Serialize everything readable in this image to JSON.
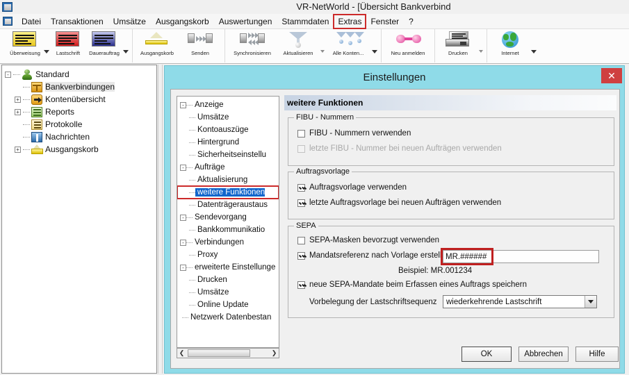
{
  "window": {
    "title": "VR-NetWorld - [Übersicht Bankverbind",
    "app_icon": "app-icon"
  },
  "menubar": {
    "items": [
      {
        "label": "Datei",
        "highlight": false
      },
      {
        "label": "Transaktionen",
        "highlight": false
      },
      {
        "label": "Umsätze",
        "highlight": false
      },
      {
        "label": "Ausgangskorb",
        "highlight": false
      },
      {
        "label": "Auswertungen",
        "highlight": false
      },
      {
        "label": "Stammdaten",
        "highlight": false
      },
      {
        "label": "Extras",
        "highlight": true
      },
      {
        "label": "Fenster",
        "highlight": false
      },
      {
        "label": "?",
        "highlight": false
      }
    ],
    "highlight_color": "#cc2a2a"
  },
  "toolbar": {
    "buttons": [
      {
        "label": "Überweisung",
        "icon": "transfer-card-icon"
      },
      {
        "label": "Lastschrift",
        "icon": "direct-debit-card-icon"
      },
      {
        "label": "Dauerauftrag",
        "icon": "standing-order-card-icon"
      },
      {
        "label": "Ausgangskorb",
        "icon": "outbox-tray-icon"
      },
      {
        "label": "Senden",
        "icon": "send-blocks-icon"
      },
      {
        "label": "Synchronisieren",
        "icon": "synchronize-blocks-icon"
      },
      {
        "label": "Aktualisieren",
        "icon": "refresh-funnel-icon"
      },
      {
        "label": "Alle Konten...",
        "icon": "all-accounts-funnels-icon"
      },
      {
        "label": "Neu anmelden",
        "icon": "relogin-plugs-icon"
      },
      {
        "label": "Drucken",
        "icon": "printer-icon"
      },
      {
        "label": "Internet",
        "icon": "globe-icon"
      }
    ]
  },
  "sidebar": {
    "items": [
      {
        "label": "Standard",
        "icon": "user-icon",
        "expander": "-",
        "level": 0,
        "selected": false
      },
      {
        "label": "Bankverbindungen",
        "icon": "bank-icon",
        "expander": "",
        "level": 1,
        "selected": true
      },
      {
        "label": "Kontenübersicht",
        "icon": "account-icon",
        "expander": "+",
        "level": 1,
        "selected": false
      },
      {
        "label": "Reports",
        "icon": "reports-icon",
        "expander": "+",
        "level": 1,
        "selected": false
      },
      {
        "label": "Protokolle",
        "icon": "protocol-icon",
        "expander": "",
        "level": 1,
        "selected": false
      },
      {
        "label": "Nachrichten",
        "icon": "messages-icon",
        "expander": "",
        "level": 1,
        "selected": false
      },
      {
        "label": "Ausgangskorb",
        "icon": "outbox-icon",
        "expander": "+",
        "level": 1,
        "selected": false
      }
    ]
  },
  "dialog": {
    "title": "Einstellungen",
    "close_label": "✕",
    "titlebar_color": "#8fdbe8",
    "close_color": "#cf4040",
    "panel_header": "weitere Funktionen",
    "tree": [
      {
        "label": "Anzeige",
        "expander": "-",
        "level": 0,
        "selected": false
      },
      {
        "label": "Umsätze",
        "expander": "",
        "level": 1,
        "selected": false
      },
      {
        "label": "Kontoauszüge",
        "expander": "",
        "level": 1,
        "selected": false
      },
      {
        "label": "Hintergrund",
        "expander": "",
        "level": 1,
        "selected": false
      },
      {
        "label": "Sicherheitseinstellu",
        "expander": "",
        "level": 1,
        "selected": false
      },
      {
        "label": "Aufträge",
        "expander": "-",
        "level": 0,
        "selected": false
      },
      {
        "label": "Aktualisierung",
        "expander": "",
        "level": 1,
        "selected": false
      },
      {
        "label": "weitere Funktionen",
        "expander": "",
        "level": 1,
        "selected": true
      },
      {
        "label": "Datenträgeraustaus",
        "expander": "",
        "level": 1,
        "selected": false
      },
      {
        "label": "Sendevorgang",
        "expander": "-",
        "level": 0,
        "selected": false
      },
      {
        "label": "Bankkommunikatio",
        "expander": "",
        "level": 1,
        "selected": false
      },
      {
        "label": "Verbindungen",
        "expander": "-",
        "level": 0,
        "selected": false
      },
      {
        "label": "Proxy",
        "expander": "",
        "level": 1,
        "selected": false
      },
      {
        "label": "erweiterte Einstellunge",
        "expander": "-",
        "level": 0,
        "selected": false
      },
      {
        "label": "Drucken",
        "expander": "",
        "level": 1,
        "selected": false
      },
      {
        "label": "Umsätze",
        "expander": "",
        "level": 1,
        "selected": false
      },
      {
        "label": "Online Update",
        "expander": "",
        "level": 1,
        "selected": false
      },
      {
        "label": "Netzwerk Datenbestan",
        "expander": "",
        "level": 0,
        "selected": false
      }
    ],
    "tree_scroll": {
      "left_arrow": "❮",
      "right_arrow": "❯"
    },
    "groups": {
      "fibu": {
        "legend": "FIBU - Nummern",
        "checkboxes": [
          {
            "label": "FIBU - Nummern verwenden",
            "checked": false,
            "disabled": false
          },
          {
            "label": "letzte FIBU - Nummer bei neuen Aufträgen verwenden",
            "checked": false,
            "disabled": true
          }
        ]
      },
      "auftragsvorlage": {
        "legend": "Auftragsvorlage",
        "checkboxes": [
          {
            "label": "Auftragsvorlage verwenden",
            "checked": true,
            "disabled": false
          },
          {
            "label": "letzte Auftragsvorlage bei neuen Aufträgen verwenden",
            "checked": true,
            "disabled": false
          }
        ]
      },
      "sepa": {
        "legend": "SEPA",
        "checkboxes": [
          {
            "label": "SEPA-Masken bevorzugt verwenden",
            "checked": false,
            "disabled": false
          },
          {
            "label": "Mandatsreferenz nach Vorlage erstellen",
            "checked": true,
            "disabled": false
          },
          {
            "label": "neue SEPA-Mandate beim Erfassen eines Auftrags speichern",
            "checked": true,
            "disabled": false
          }
        ],
        "mandate_template_value": "MR.######",
        "mandate_template_highlight": "#c02020",
        "example_text": "Beispiel: MR.001234",
        "sequence_label": "Vorbelegung der Lastschriftsequenz",
        "sequence_value": "wiederkehrende Lastschrift"
      }
    },
    "buttons": {
      "ok": "OK",
      "cancel": "Abbrechen",
      "help": "Hilfe"
    }
  }
}
